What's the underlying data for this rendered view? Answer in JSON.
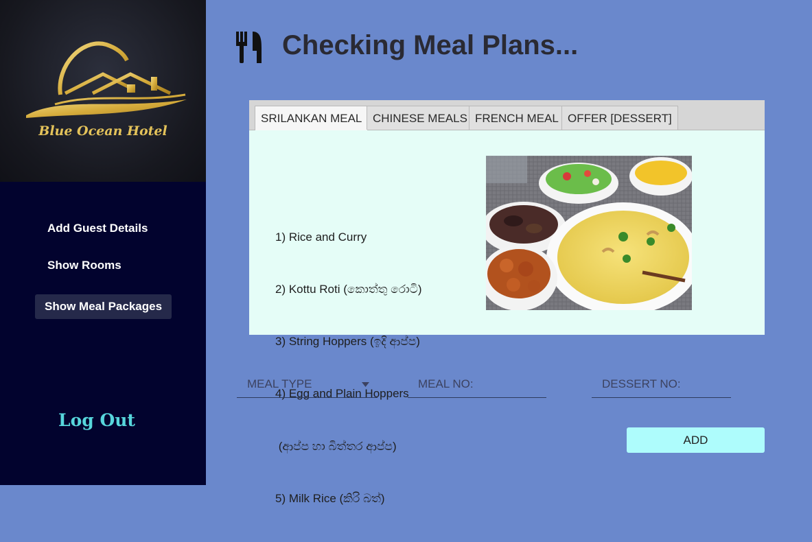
{
  "sidebar": {
    "hotel_name": "Blue Ocean Hotel",
    "nav_items": [
      {
        "label": "Add Guest Details"
      },
      {
        "label": "Show Rooms"
      },
      {
        "label": "Show Meal Packages"
      }
    ],
    "active_item": "Show Meal Packages",
    "logout_label": "Log Out"
  },
  "header": {
    "title": "Checking Meal Plans...",
    "icon": "cutlery-icon"
  },
  "tabs": [
    {
      "label": "SRILANKAN MEAL"
    },
    {
      "label": "CHINESE MEALS"
    },
    {
      "label": "FRENCH MEAL"
    },
    {
      "label": "OFFER [DESSERT]"
    }
  ],
  "active_tab": "SRILANKAN MEAL",
  "menu": {
    "items": [
      "1) Rice and Curry",
      "2) Kottu Roti (කොත්තු රොටි)",
      "3) String Hoppers (ඉදි ආප්ප)",
      "4) Egg and Plain Hoppers",
      " (ආප්ප හා බිත්තර ආප්ප)",
      "5) Milk Rice (කිරි බත්)"
    ]
  },
  "form": {
    "meal_type_label": "MEAL TYPE",
    "meal_no_placeholder": "MEAL NO:",
    "dessert_no_placeholder": "DESSERT NO:",
    "add_label": "ADD"
  },
  "colors": {
    "sidebar_bg": "#02032e",
    "main_bg": "#6a88cc",
    "accent_logout": "#57d6dc",
    "gold": "#e3c25a",
    "add_button": "#aefcfc"
  }
}
